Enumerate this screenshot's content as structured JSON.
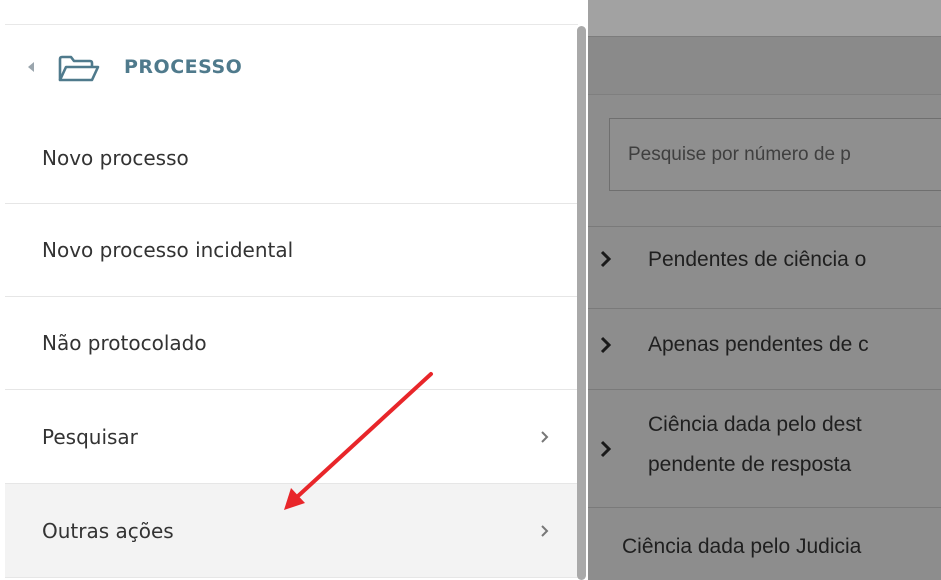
{
  "menu": {
    "title": "PROCESSO",
    "items": [
      {
        "label": "Novo processo",
        "has_submenu": false
      },
      {
        "label": "Novo processo incidental",
        "has_submenu": false
      },
      {
        "label": "Não protocolado",
        "has_submenu": false
      },
      {
        "label": "Pesquisar",
        "has_submenu": true
      },
      {
        "label": "Outras ações",
        "has_submenu": true
      }
    ]
  },
  "right_panel": {
    "search_placeholder": "Pesquise por número de p",
    "filters": [
      {
        "label": "Pendentes de ciência o"
      },
      {
        "label": "Apenas pendentes de c"
      },
      {
        "label_line1": "Ciência dada pelo dest",
        "label_line2": "pendente de resposta"
      }
    ],
    "bottom_label": "Ciência dada pelo Judicia"
  },
  "colors": {
    "title": "#4f7a8c",
    "annotation_arrow": "#e8262a",
    "overlay": "#8d8d8d"
  },
  "icons": [
    "caret-left-icon",
    "folder-open-icon",
    "chevron-right-icon"
  ]
}
